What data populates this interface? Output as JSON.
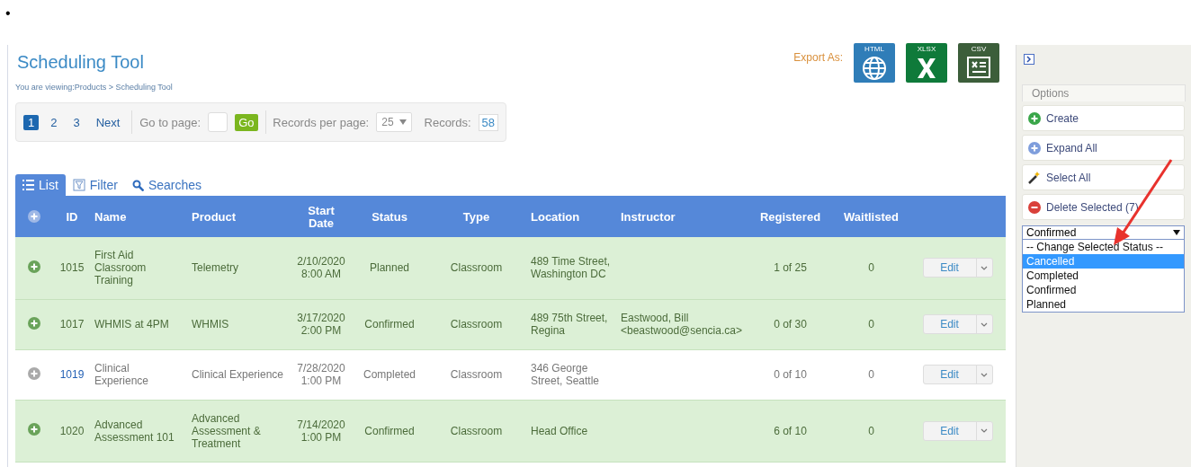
{
  "bullet": "•",
  "page": {
    "title": "Scheduling Tool",
    "breadcrumb": "You are viewing:Products > Scheduling Tool"
  },
  "pagination": {
    "pages": [
      {
        "label": "1",
        "selected": true
      },
      {
        "label": "2",
        "selected": false
      },
      {
        "label": "3",
        "selected": false
      }
    ],
    "next": "Next",
    "goto_label": "Go to page:",
    "go": "Go",
    "per_page_label": "Records per page:",
    "per_page": "25",
    "records_label": "Records:",
    "records": "58"
  },
  "export": {
    "label": "Export As:",
    "formats": [
      {
        "kind": "html",
        "label": "HTML"
      },
      {
        "kind": "xlsx",
        "label": "XLSX"
      },
      {
        "kind": "csv",
        "label": "CSV"
      }
    ]
  },
  "tabs": [
    {
      "kind": "list",
      "label": "List",
      "selected": true
    },
    {
      "kind": "filter",
      "label": "Filter",
      "selected": false
    },
    {
      "kind": "search",
      "label": "Searches",
      "selected": false
    }
  ],
  "table": {
    "columns": [
      "ID",
      "Name",
      "Product",
      "Start Date",
      "Status",
      "Type",
      "Location",
      "Instructor",
      "Registered",
      "Waitlisted"
    ],
    "rows": [
      {
        "selected": true,
        "cells": [
          "1015",
          "First Aid Classroom Training",
          "Telemetry",
          "2/10/2020 8:00 AM",
          "Planned",
          "Classroom",
          "489 Time Street, Washington DC",
          "",
          "1 of 25",
          "0"
        ],
        "action": "Edit"
      },
      {
        "selected": true,
        "cells": [
          "1017",
          "WHMIS at 4PM",
          "WHMIS",
          "3/17/2020 2:00 PM",
          "Confirmed",
          "Classroom",
          "489 75th Street, Regina",
          "Eastwood, Bill <beastwood@sencia.ca>",
          "0 of 30",
          "0"
        ],
        "action": "Edit"
      },
      {
        "selected": false,
        "cells": [
          "1019",
          "Clinical Experience",
          "Clinical Experience",
          "7/28/2020 1:00 PM",
          "Completed",
          "Classroom",
          "346 George Street, Seattle",
          "",
          "0 of 10",
          "0"
        ],
        "action": "Edit"
      },
      {
        "selected": true,
        "cells": [
          "1020",
          "Advanced Assessment 101",
          "Advanced Assessment & Treatment",
          "7/14/2020 1:00 PM",
          "Confirmed",
          "Classroom",
          "Head Office",
          "",
          "6 of 10",
          "0"
        ],
        "action": "Edit"
      }
    ]
  },
  "sidebar": {
    "tab": "Options",
    "buttons": [
      {
        "kind": "create",
        "label": "Create"
      },
      {
        "kind": "expand",
        "label": "Expand All"
      },
      {
        "kind": "select",
        "label": "Select All"
      },
      {
        "kind": "delete",
        "label": "Delete Selected (7)"
      }
    ],
    "status_select": {
      "value": "Confirmed",
      "options": [
        {
          "label": "-- Change Selected Status --",
          "highlighted": false
        },
        {
          "label": "Cancelled",
          "highlighted": true
        },
        {
          "label": "Completed",
          "highlighted": false
        },
        {
          "label": "Confirmed",
          "highlighted": false
        },
        {
          "label": "Planned",
          "highlighted": false
        }
      ]
    }
  }
}
